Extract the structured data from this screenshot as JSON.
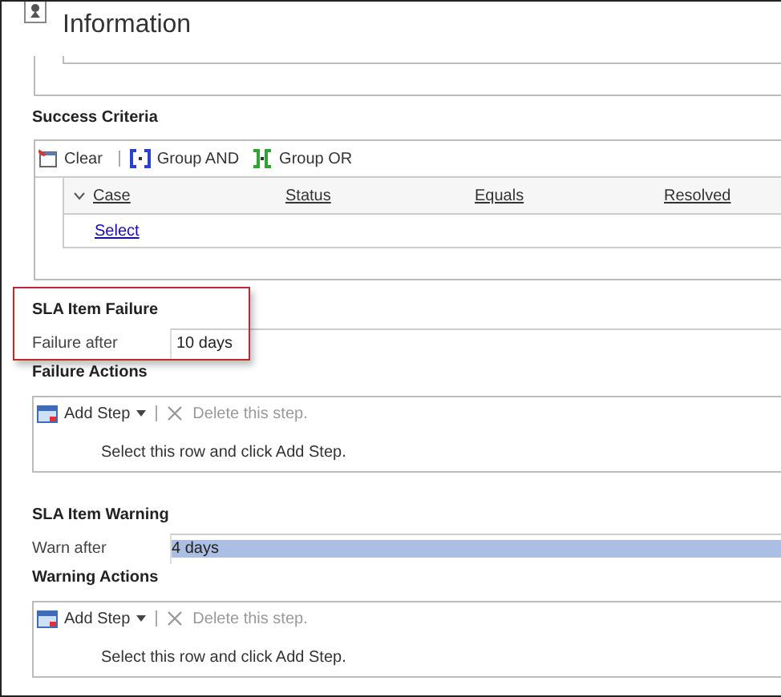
{
  "header": {
    "title": "Information"
  },
  "success_criteria": {
    "heading": "Success Criteria",
    "toolbar": [
      {
        "kind": "clear",
        "label": "Clear"
      },
      {
        "kind": "and",
        "label": "Group AND"
      },
      {
        "kind": "or",
        "label": "Group OR"
      }
    ],
    "columns": [
      "Case",
      "Status",
      "Equals",
      "Resolved"
    ],
    "link": "Select"
  },
  "sections": [
    {
      "heading": "SLA Item Failure",
      "highlighted": true,
      "field_label": "Failure after",
      "field_value": "10 days",
      "value_selected": false,
      "actions_heading": "Failure Actions",
      "add_label": "Add Step",
      "delete_label": "Delete this step.",
      "hint": "Select this row and click Add Step."
    },
    {
      "heading": "SLA Item Warning",
      "highlighted": false,
      "field_label": "Warn after",
      "field_value": "4 days",
      "value_selected": true,
      "actions_heading": "Warning Actions",
      "add_label": "Add Step",
      "delete_label": "Delete this step.",
      "hint": "Select this row and click Add Step."
    }
  ]
}
